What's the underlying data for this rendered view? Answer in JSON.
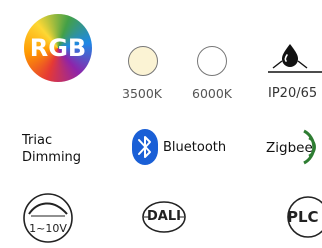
{
  "rgb": {
    "label": "RGB"
  },
  "color_temps": [
    {
      "label": "3500K",
      "fill": "#fbf3d4"
    },
    {
      "label": "6000K",
      "fill": "#ffffff"
    }
  ],
  "ip_rating": {
    "label": "IP20/65"
  },
  "triac": {
    "line1": "Triac",
    "line2": "Dimming"
  },
  "bluetooth": {
    "label": "Bluetooth",
    "icon": "bluetooth-icon",
    "color": "#1a5fd6"
  },
  "zigbee": {
    "label": "Zigbee",
    "icon": "zigbee-signal-icon",
    "color": "#2e7d32"
  },
  "dimming_0_10v": {
    "label": "1~10V",
    "icon": "dimming-curve-icon"
  },
  "dali": {
    "label": "DALI"
  },
  "plc": {
    "label": "PLC"
  }
}
